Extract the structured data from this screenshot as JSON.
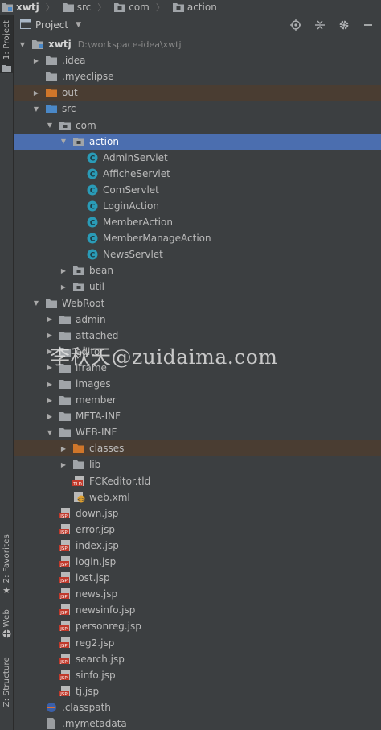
{
  "breadcrumb": [
    {
      "label": "xwtj",
      "icon": "module-icon",
      "bold": true
    },
    {
      "label": "src",
      "icon": "folder-icon"
    },
    {
      "label": "com",
      "icon": "package-icon"
    },
    {
      "label": "action",
      "icon": "package-icon"
    }
  ],
  "tool_stripe": {
    "project": "1: Project",
    "favorites": "2: Favorites",
    "web": "Web",
    "structure": "Z: Structure"
  },
  "panel": {
    "view_label": "Project",
    "icons": [
      "locate-icon",
      "collapse-all-icon",
      "settings-gear-icon",
      "hide-panel-icon"
    ]
  },
  "tree": [
    {
      "label": "xwtj",
      "path": "D:\\workspace-idea\\xwtj",
      "depth": 0,
      "arrow": "open",
      "icon": "module",
      "bold": true
    },
    {
      "label": ".idea",
      "depth": 1,
      "arrow": "closed",
      "icon": "folder"
    },
    {
      "label": ".myeclipse",
      "depth": 1,
      "arrow": "none",
      "icon": "folder"
    },
    {
      "label": "out",
      "depth": 1,
      "arrow": "closed",
      "icon": "folder-orange",
      "state": "excluded"
    },
    {
      "label": "src",
      "depth": 1,
      "arrow": "open",
      "icon": "folder-source"
    },
    {
      "label": "com",
      "depth": 2,
      "arrow": "open",
      "icon": "package"
    },
    {
      "label": "action",
      "depth": 3,
      "arrow": "open",
      "icon": "package",
      "state": "selected"
    },
    {
      "label": "AdminServlet",
      "depth": 4,
      "arrow": "none",
      "icon": "class"
    },
    {
      "label": "AfficheServlet",
      "depth": 4,
      "arrow": "none",
      "icon": "class"
    },
    {
      "label": "ComServlet",
      "depth": 4,
      "arrow": "none",
      "icon": "class"
    },
    {
      "label": "LoginAction",
      "depth": 4,
      "arrow": "none",
      "icon": "class"
    },
    {
      "label": "MemberAction",
      "depth": 4,
      "arrow": "none",
      "icon": "class"
    },
    {
      "label": "MemberManageAction",
      "depth": 4,
      "arrow": "none",
      "icon": "class"
    },
    {
      "label": "NewsServlet",
      "depth": 4,
      "arrow": "none",
      "icon": "class"
    },
    {
      "label": "bean",
      "depth": 3,
      "arrow": "closed",
      "icon": "package"
    },
    {
      "label": "util",
      "depth": 3,
      "arrow": "closed",
      "icon": "package"
    },
    {
      "label": "WebRoot",
      "depth": 1,
      "arrow": "open",
      "icon": "folder"
    },
    {
      "label": "admin",
      "depth": 2,
      "arrow": "closed",
      "icon": "folder"
    },
    {
      "label": "attached",
      "depth": 2,
      "arrow": "closed",
      "icon": "folder"
    },
    {
      "label": "editor",
      "depth": 2,
      "arrow": "closed",
      "icon": "folder"
    },
    {
      "label": "iframe",
      "depth": 2,
      "arrow": "closed",
      "icon": "folder"
    },
    {
      "label": "images",
      "depth": 2,
      "arrow": "closed",
      "icon": "folder"
    },
    {
      "label": "member",
      "depth": 2,
      "arrow": "closed",
      "icon": "folder"
    },
    {
      "label": "META-INF",
      "depth": 2,
      "arrow": "closed",
      "icon": "folder"
    },
    {
      "label": "WEB-INF",
      "depth": 2,
      "arrow": "open",
      "icon": "folder"
    },
    {
      "label": "classes",
      "depth": 3,
      "arrow": "closed",
      "icon": "folder-orange",
      "state": "excluded"
    },
    {
      "label": "lib",
      "depth": 3,
      "arrow": "closed",
      "icon": "folder"
    },
    {
      "label": "FCKeditor.tld",
      "depth": 3,
      "arrow": "none",
      "icon": "tld"
    },
    {
      "label": "web.xml",
      "depth": 3,
      "arrow": "none",
      "icon": "xml"
    },
    {
      "label": "down.jsp",
      "depth": 2,
      "arrow": "none",
      "icon": "jsp"
    },
    {
      "label": "error.jsp",
      "depth": 2,
      "arrow": "none",
      "icon": "jsp"
    },
    {
      "label": "index.jsp",
      "depth": 2,
      "arrow": "none",
      "icon": "jsp"
    },
    {
      "label": "login.jsp",
      "depth": 2,
      "arrow": "none",
      "icon": "jsp"
    },
    {
      "label": "lost.jsp",
      "depth": 2,
      "arrow": "none",
      "icon": "jsp"
    },
    {
      "label": "news.jsp",
      "depth": 2,
      "arrow": "none",
      "icon": "jsp"
    },
    {
      "label": "newsinfo.jsp",
      "depth": 2,
      "arrow": "none",
      "icon": "jsp"
    },
    {
      "label": "personreg.jsp",
      "depth": 2,
      "arrow": "none",
      "icon": "jsp"
    },
    {
      "label": "reg2.jsp",
      "depth": 2,
      "arrow": "none",
      "icon": "jsp"
    },
    {
      "label": "search.jsp",
      "depth": 2,
      "arrow": "none",
      "icon": "jsp"
    },
    {
      "label": "sinfo.jsp",
      "depth": 2,
      "arrow": "none",
      "icon": "jsp"
    },
    {
      "label": "tj.jsp",
      "depth": 2,
      "arrow": "none",
      "icon": "jsp"
    },
    {
      "label": ".classpath",
      "depth": 1,
      "arrow": "none",
      "icon": "classpath"
    },
    {
      "label": ".mymetadata",
      "depth": 1,
      "arrow": "none",
      "icon": "file"
    }
  ],
  "watermark": "李秋天@zuidaima.com",
  "colors": {
    "background": "#3c3f41",
    "selection": "#4b6eaf",
    "excluded_row": "#4a3d32",
    "folder": "#a0a4a8",
    "folder_orange": "#d0762a",
    "class_badge": "#2a9bb7",
    "jsp_badge": "#c0392b"
  }
}
